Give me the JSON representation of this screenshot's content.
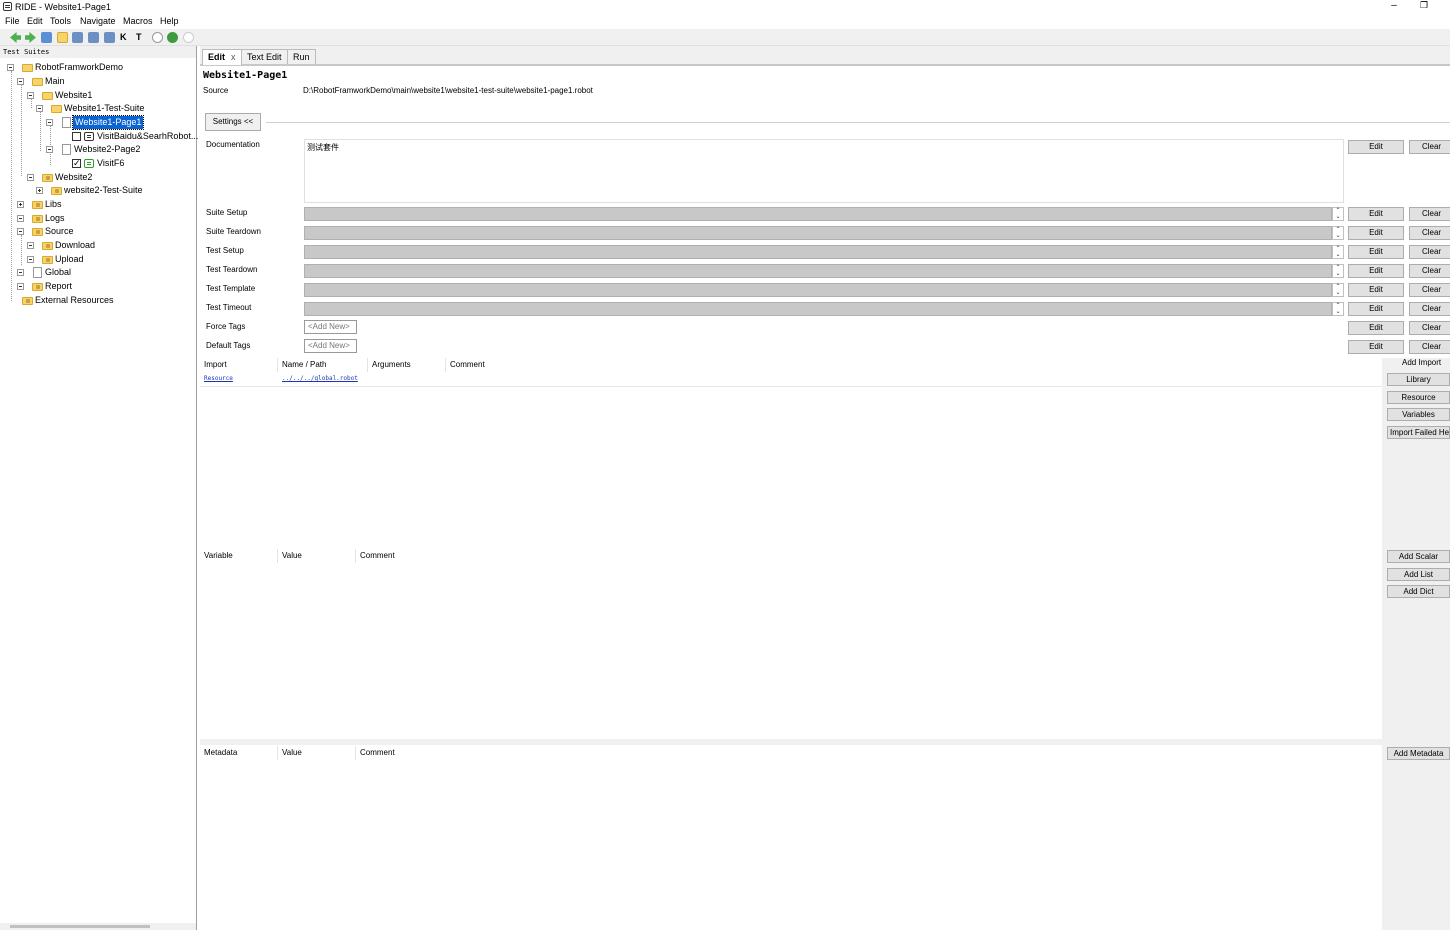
{
  "window": {
    "title": "RIDE - Website1-Page1",
    "minimize": "–",
    "restore": "❐"
  },
  "menu": [
    "File",
    "Edit",
    "Tools",
    "Navigate",
    "Macros",
    "Help"
  ],
  "toolbar": {
    "icons": [
      "back-icon",
      "forward-icon",
      "open-icon",
      "new-icon",
      "save-icon",
      "save-all-icon",
      "copy-icon",
      "keyword-icon",
      "text-icon",
      "cursor-icon",
      "play-icon",
      "bug-icon",
      "stop-icon"
    ],
    "keyword_glyph": "K",
    "text_glyph": "T"
  },
  "tree": {
    "header": "Test Suites",
    "items": [
      {
        "label": "RobotFramworkDemo"
      },
      {
        "label": "Main"
      },
      {
        "label": "Website1"
      },
      {
        "label": "Website1-Test-Suite"
      },
      {
        "label": "Website1-Page1"
      },
      {
        "label": "VisitBaidu&SearhRobot..."
      },
      {
        "label": "Website2-Page2"
      },
      {
        "label": "VisitF6"
      },
      {
        "label": "Website2"
      },
      {
        "label": "website2-Test-Suite"
      },
      {
        "label": "Libs"
      },
      {
        "label": "Logs"
      },
      {
        "label": "Source"
      },
      {
        "label": "Download"
      },
      {
        "label": "Upload"
      },
      {
        "label": "Global"
      },
      {
        "label": "Report"
      },
      {
        "label": "External Resources"
      }
    ]
  },
  "tabs": [
    {
      "label": "Edit",
      "close": "x"
    },
    {
      "label": "Text Edit"
    },
    {
      "label": "Run"
    }
  ],
  "editor": {
    "suite_title": "Website1-Page1",
    "source_label": "Source",
    "source_path": "D:\\RobotFramworkDemo\\main\\website1\\website1-test-suite\\website1-page1.robot",
    "settings_button": "Settings <<",
    "documentation_label": "Documentation",
    "documentation_value": "测试套件",
    "settings": [
      {
        "label": "Suite Setup"
      },
      {
        "label": "Suite Teardown"
      },
      {
        "label": "Test Setup"
      },
      {
        "label": "Test Teardown"
      },
      {
        "label": "Test Template"
      },
      {
        "label": "Test Timeout"
      }
    ],
    "force_tags_label": "Force Tags",
    "default_tags_label": "Default Tags",
    "add_new": "<Add New>",
    "edit_label": "Edit",
    "clear_label": "Clear",
    "spin_up": "⌃",
    "spin_down": "⌄"
  },
  "imports": {
    "columns": [
      "Import",
      "Name / Path",
      "Arguments",
      "Comment"
    ],
    "rows": [
      {
        "type": "Resource",
        "path": "../../../global.robot"
      }
    ],
    "add_import_label": "Add Import",
    "buttons": [
      "Library",
      "Resource",
      "Variables",
      "Import Failed Help"
    ]
  },
  "variables": {
    "columns": [
      "Variable",
      "Value",
      "Comment"
    ],
    "buttons": [
      "Add Scalar",
      "Add List",
      "Add Dict"
    ]
  },
  "metadata": {
    "columns": [
      "Metadata",
      "Value",
      "Comment"
    ],
    "buttons": [
      "Add Metadata"
    ]
  }
}
